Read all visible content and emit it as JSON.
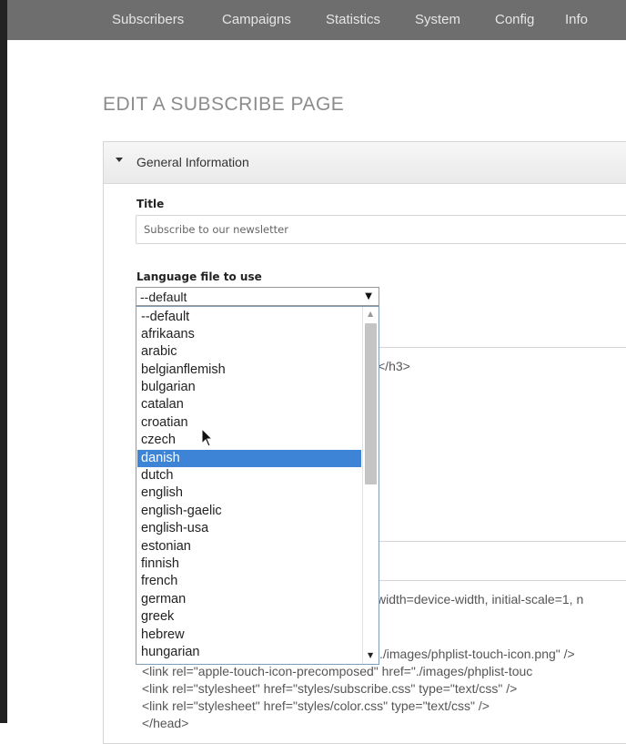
{
  "nav": {
    "items": [
      "Subscribers",
      "Campaigns",
      "Statistics",
      "System",
      "Config",
      "Info"
    ]
  },
  "page_title": "EDIT A SUBSCRIBE PAGE",
  "panel": {
    "title": "General Information"
  },
  "form": {
    "title_label": "Title",
    "title_value": "Subscribe to our newsletter",
    "language_label": "Language file to use",
    "language_selected": "--default"
  },
  "language_options": [
    "--default",
    "afrikaans",
    "arabic",
    "belgianflemish",
    "bulgarian",
    "catalan",
    "croatian",
    "czech",
    "danish",
    "dutch",
    "english",
    "english-gaelic",
    "english-usa",
    "estonian",
    "finnish",
    "french",
    "german",
    "greek",
    "hebrew",
    "hungarian"
  ],
  "highlighted_option": "danish",
  "editor": {
    "line1": "</h3>",
    "line2": "width=device-width, initial-scale=1, n",
    "line3": "./images/phplist-touch-icon.png\" />",
    "line4": "<link rel=\"apple-touch-icon-precomposed\" href=\"./images/phplist-touc",
    "line5": "<link rel=\"stylesheet\" href=\"styles/subscribe.css\" type=\"text/css\" />",
    "line6": "<link rel=\"stylesheet\" href=\"styles/color.css\" type=\"text/css\" />",
    "line7": "</head>"
  },
  "colors": {
    "nav_bg": "#6e6e6e",
    "highlight": "#3d83d6"
  }
}
